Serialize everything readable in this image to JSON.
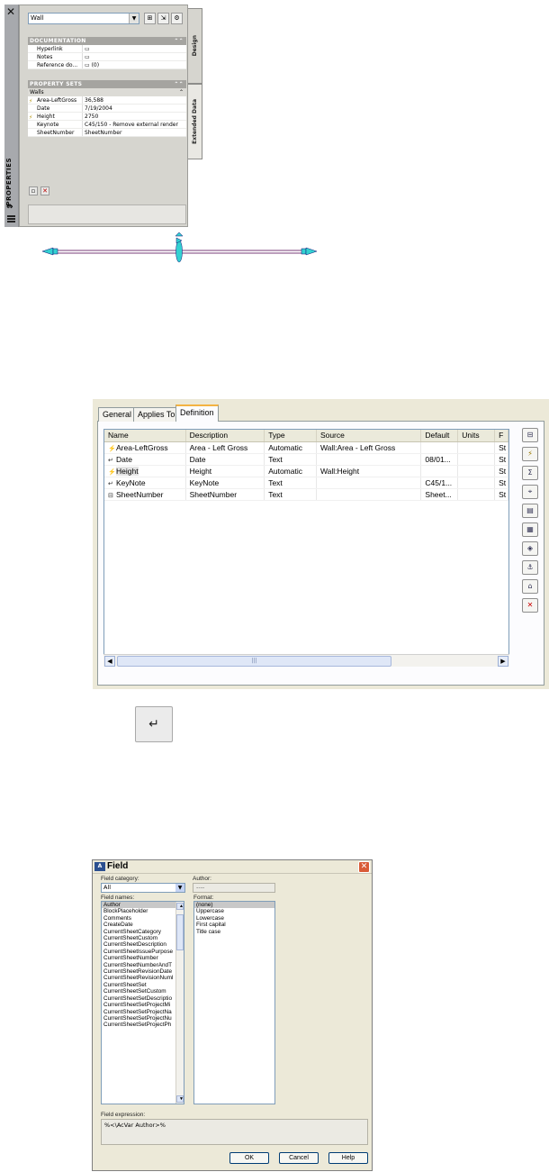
{
  "properties_palette": {
    "title": "PROPERTIES",
    "object_type": "Wall",
    "tabs": [
      "Design",
      "Extended Data"
    ],
    "documentation": {
      "header": "DOCUMENTATION",
      "rows": [
        {
          "key": "Hyperlink",
          "value": ""
        },
        {
          "key": "Notes",
          "value": ""
        },
        {
          "key": "Reference do...",
          "value": "(0)"
        }
      ]
    },
    "property_sets": {
      "header": "PROPERTY SETS",
      "group": "Walls",
      "rows": [
        {
          "key": "Area-LeftGross",
          "value": "36,588",
          "auto": true
        },
        {
          "key": "Date",
          "value": "7/19/2004",
          "auto": false
        },
        {
          "key": "Height",
          "value": "2750",
          "auto": true
        },
        {
          "key": "Keynote",
          "value": "C45/150 - Remove external render",
          "auto": false
        },
        {
          "key": "SheetNumber",
          "value": "SheetNumber",
          "auto": false
        }
      ]
    }
  },
  "definition_dialog": {
    "tabs": [
      "General",
      "Applies To",
      "Definition"
    ],
    "active_tab": "Definition",
    "columns": [
      "Name",
      "Description",
      "Type",
      "Source",
      "Default",
      "Units",
      "F"
    ],
    "rows": [
      {
        "name": "Area-LeftGross",
        "description": "Area - Left Gross",
        "type": "Automatic",
        "source": "Wall:Area - Left Gross",
        "default": "",
        "units": "",
        "f": "St",
        "icon": "auto-property-icon"
      },
      {
        "name": "Date",
        "description": "Date",
        "type": "Text",
        "source": "",
        "default": "08/01...",
        "units": "",
        "f": "St",
        "icon": "manual-property-icon"
      },
      {
        "name": "Height",
        "description": "Height",
        "type": "Automatic",
        "source": "Wall:Height",
        "default": "",
        "units": "",
        "f": "St",
        "icon": "auto-property-icon"
      },
      {
        "name": "KeyNote",
        "description": "KeyNote",
        "type": "Text",
        "source": "",
        "default": "C45/1...",
        "units": "",
        "f": "St",
        "icon": "manual-property-icon"
      },
      {
        "name": "SheetNumber",
        "description": "SheetNumber",
        "type": "Text",
        "source": "",
        "default": "Sheet...",
        "units": "",
        "f": "St",
        "icon": "formula-property-icon"
      }
    ]
  },
  "field_dialog": {
    "title": "Field",
    "category_label": "Field category:",
    "category_value": "All",
    "author_label": "Author:",
    "author_value": "----",
    "names_label": "Field names:",
    "field_names": [
      "Author",
      "BlockPlaceholder",
      "Comments",
      "CreateDate",
      "CurrentSheetCategory",
      "CurrentSheetCustom",
      "CurrentSheetDescription",
      "CurrentSheetIssuePurpose",
      "CurrentSheetNumber",
      "CurrentSheetNumberAndT",
      "CurrentSheetRevisionDate",
      "CurrentSheetRevisionNuml",
      "CurrentSheetSet",
      "CurrentSheetSetCustom",
      "CurrentSheetSetDescriptio",
      "CurrentSheetSetProjectMi",
      "CurrentSheetSetProjectNa",
      "CurrentSheetSetProjectNu",
      "CurrentSheetSetProjectPh"
    ],
    "format_label": "Format:",
    "formats": [
      "(none)",
      "Uppercase",
      "Lowercase",
      "First capital",
      "Title case"
    ],
    "expression_label": "Field expression:",
    "expression": "%<\\AcVar Author>%",
    "buttons": {
      "ok": "OK",
      "cancel": "Cancel",
      "help": "Help"
    }
  }
}
